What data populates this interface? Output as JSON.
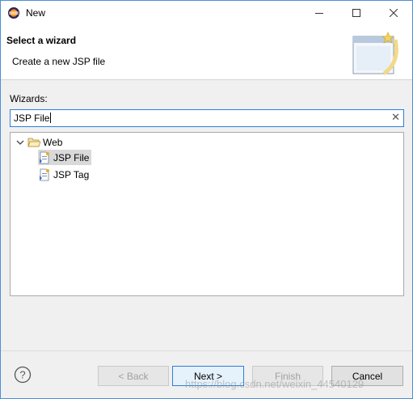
{
  "window": {
    "title": "New",
    "icons": [
      "eclipse-app-icon",
      "minimize-icon",
      "maximize-icon",
      "close-icon"
    ]
  },
  "header": {
    "title": "Select a wizard",
    "description": "Create a new JSP file",
    "art_icon": "wizard-banner-icon"
  },
  "wizards": {
    "label": "Wizards:",
    "filter_value": "JSP File",
    "clear_icon": "clear-icon"
  },
  "tree": {
    "folder": {
      "label": "Web",
      "expanded": true,
      "icon": "open-folder-icon"
    },
    "items": [
      {
        "label": "JSP File",
        "selected": true,
        "icon": "jsp-file-icon"
      },
      {
        "label": "JSP Tag",
        "selected": false,
        "icon": "jsp-file-icon"
      }
    ]
  },
  "buttons": {
    "help_icon": "help-icon",
    "back": "< Back",
    "next": "Next >",
    "finish": "Finish",
    "cancel": "Cancel"
  },
  "watermark": "https://blog.csdn.net/weixin_44540129",
  "colors": {
    "accent": "#2f7ed8",
    "selection": "#d9d9d9",
    "window_border": "#4a8fd6"
  }
}
